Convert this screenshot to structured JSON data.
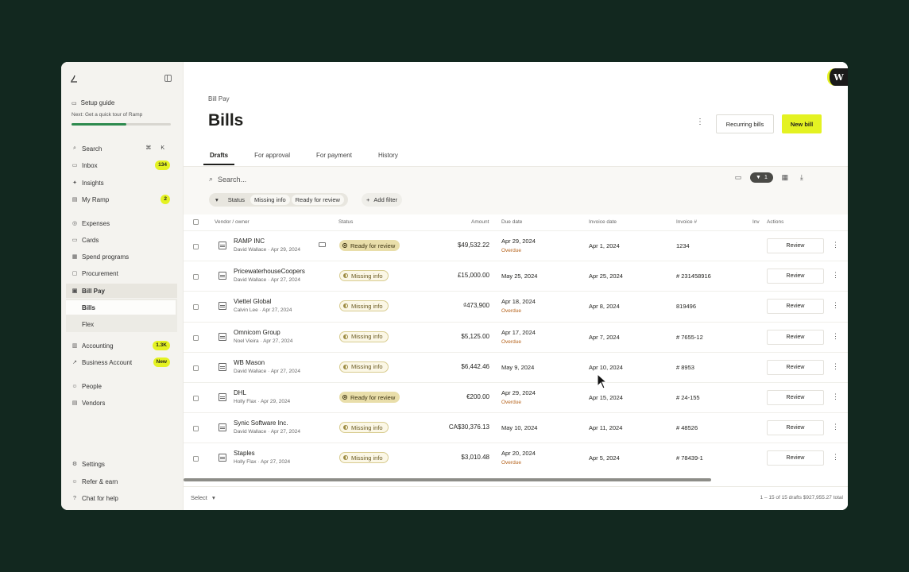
{
  "sidebar": {
    "setup_title": "Setup guide",
    "setup_sub": "Next: Get a quick tour of Ramp",
    "setup_progress_percent": 55,
    "search_label": "Search",
    "search_shortcut": "⌘ K",
    "items": [
      {
        "label": "Inbox",
        "badge": "134",
        "icon": "inbox-icon",
        "glyph": "▭"
      },
      {
        "label": "Insights",
        "badge": "",
        "icon": "insights-icon",
        "glyph": "✦"
      },
      {
        "label": "My Ramp",
        "badge": "2",
        "icon": "my-ramp-icon",
        "glyph": "▤"
      },
      {
        "label": "Expenses",
        "badge": "",
        "icon": "expenses-icon",
        "glyph": "◎"
      },
      {
        "label": "Cards",
        "badge": "",
        "icon": "cards-icon",
        "glyph": "▭"
      },
      {
        "label": "Spend programs",
        "badge": "",
        "icon": "spend-programs-icon",
        "glyph": "▦"
      },
      {
        "label": "Procurement",
        "badge": "",
        "icon": "procurement-icon",
        "glyph": "▢"
      },
      {
        "label": "Bill Pay",
        "badge": "",
        "icon": "bill-pay-icon",
        "glyph": "▣"
      },
      {
        "label": "Bills",
        "badge": ""
      },
      {
        "label": "Flex",
        "badge": ""
      },
      {
        "label": "Accounting",
        "badge": "1.3K",
        "icon": "accounting-icon",
        "glyph": "▥"
      },
      {
        "label": "Business Account",
        "badge": "New",
        "icon": "business-account-icon",
        "glyph": "↗"
      },
      {
        "label": "People",
        "badge": "",
        "icon": "people-icon",
        "glyph": "☺"
      },
      {
        "label": "Vendors",
        "badge": "",
        "icon": "vendors-icon",
        "glyph": "▤"
      },
      {
        "label": "Settings",
        "badge": "",
        "icon": "settings-icon",
        "glyph": "⚙"
      },
      {
        "label": "Refer & earn",
        "badge": "",
        "icon": "refer-icon",
        "glyph": "☺"
      },
      {
        "label": "Chat for help",
        "badge": "",
        "icon": "chat-icon",
        "glyph": "?"
      }
    ]
  },
  "header": {
    "breadcrumb": "Bill Pay",
    "title": "Bills",
    "more": "⋮",
    "recurring_label": "Recurring bills",
    "new_label": "New bill",
    "logo_letter": "W"
  },
  "tabs": [
    "Drafts",
    "For approval",
    "For payment",
    "History"
  ],
  "search": {
    "placeholder": "Search..."
  },
  "filters": {
    "status_label": "Status",
    "values": [
      "Missing info",
      "Ready for review"
    ],
    "add_label": "Add filter",
    "active_count": "1"
  },
  "columns": {
    "vendor": "Vendor / owner",
    "status": "Status",
    "amount": "Amount",
    "due": "Due date",
    "invdate": "Invoice date",
    "invno": "Invoice #",
    "inv_cut": "Inv",
    "actions": "Actions"
  },
  "rows": [
    {
      "vendor": "RAMP INC",
      "owner": "David Wallace · Apr 29, 2024",
      "card": true,
      "status": "Ready for review",
      "amount": "$49,532.22",
      "due": "Apr 29, 2024",
      "overdue": "Overdue",
      "invdate": "Apr 1, 2024",
      "invno": "1234",
      "action": "Review"
    },
    {
      "vendor": "PricewaterhouseCoopers",
      "owner": "David Wallace · Apr 27, 2024",
      "card": false,
      "status": "Missing info",
      "amount": "£15,000.00",
      "due": "May 25, 2024",
      "overdue": "",
      "invdate": "Apr 25, 2024",
      "invno": "# 231458916",
      "action": "Review"
    },
    {
      "vendor": "Viettel Global",
      "owner": "Calvin Lee · Apr 27, 2024",
      "card": false,
      "status": "Missing info",
      "amount": "₫473,900",
      "due": "Apr 18, 2024",
      "overdue": "Overdue",
      "invdate": "Apr 8, 2024",
      "invno": "819496",
      "action": "Review"
    },
    {
      "vendor": "Omnicom Group",
      "owner": "Noel Vieira · Apr 27, 2024",
      "card": false,
      "status": "Missing info",
      "amount": "$5,125.00",
      "due": "Apr 17, 2024",
      "overdue": "Overdue",
      "invdate": "Apr 7, 2024",
      "invno": "# 7655-12",
      "action": "Review"
    },
    {
      "vendor": "WB Mason",
      "owner": "David Wallace · Apr 27, 2024",
      "card": false,
      "status": "Missing info",
      "amount": "$6,442.46",
      "due": "May 9, 2024",
      "overdue": "",
      "invdate": "Apr 10, 2024",
      "invno": "# 8953",
      "action": "Review"
    },
    {
      "vendor": "DHL",
      "owner": "Holly Flax · Apr 29, 2024",
      "card": false,
      "status": "Ready for review",
      "amount": "€200.00",
      "due": "Apr 29, 2024",
      "overdue": "Overdue",
      "invdate": "Apr 15, 2024",
      "invno": "# 24-155",
      "action": "Review"
    },
    {
      "vendor": "Synic Software Inc.",
      "owner": "David Wallace · Apr 27, 2024",
      "card": false,
      "status": "Missing info",
      "amount": "CA$30,376.13",
      "due": "May 10, 2024",
      "overdue": "",
      "invdate": "Apr 11, 2024",
      "invno": "# 48526",
      "action": "Review"
    },
    {
      "vendor": "Staples",
      "owner": "Holly Flax · Apr 27, 2024",
      "card": false,
      "status": "Missing info",
      "amount": "$3,010.48",
      "due": "Apr 20, 2024",
      "overdue": "Overdue",
      "invdate": "Apr 5, 2024",
      "invno": "# 78439-1",
      "action": "Review"
    }
  ],
  "footer": {
    "select_label": "Select",
    "info": "1 – 15 of 15 drafts   $927,955.27 total"
  },
  "colors": {
    "accent": "#e4f222",
    "bg": "#12281f",
    "overdue": "#b5621a"
  }
}
